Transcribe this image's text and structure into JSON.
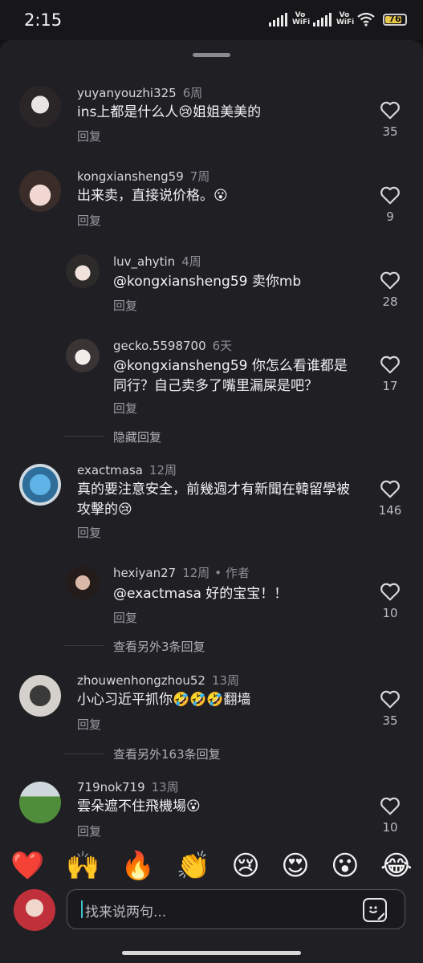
{
  "status": {
    "time": "2:15",
    "network1": "Vo\nWiFi",
    "network2": "Vo\nWiFi",
    "battery": "76"
  },
  "comments": [
    {
      "username": "yuyanyouzhi325",
      "time": "6周",
      "text": "ins上都是什么人😢姐姐美美的",
      "reply": "回复",
      "likes": "35"
    },
    {
      "username": "kongxiansheng59",
      "time": "7周",
      "text": "出来卖，直接说价格。😮",
      "reply": "回复",
      "likes": "9"
    },
    {
      "username": "luv_ahytin",
      "time": "4周",
      "text": "@kongxiansheng59 卖你mb",
      "reply": "回复",
      "likes": "28"
    },
    {
      "username": "gecko.5598700",
      "time": "6天",
      "text": "@kongxiansheng59 你怎么看谁都是同行？自己卖多了嘴里漏屎是吧？",
      "reply": "回复",
      "likes": "17"
    },
    {
      "username": "exactmasa",
      "time": "12周",
      "text": "真的要注意安全，前幾週才有新聞在韓留學被攻擊的😢",
      "reply": "回复",
      "likes": "146"
    },
    {
      "username": "hexiyan27",
      "time": "12周",
      "author": "• 作者",
      "text": "@exactmasa 好的宝宝！！",
      "reply": "回复",
      "likes": "10"
    },
    {
      "username": "zhouwenhongzhou52",
      "time": "13周",
      "text": "小心习近平抓你🤣🤣🤣翻墙",
      "reply": "回复",
      "likes": "35"
    },
    {
      "username": "719nok719",
      "time": "13周",
      "text": "雲朵遮不住飛機場😮",
      "reply": "回复",
      "likes": "10"
    }
  ],
  "thread_actions": {
    "hide_replies": "隐藏回复",
    "view_more_1": "查看另外3条回复",
    "view_more_2": "查看另外163条回复"
  },
  "emoji_bar": [
    "❤️",
    "🙌",
    "🔥",
    "👏",
    "😢",
    "😍",
    "😮",
    "😂"
  ],
  "input": {
    "placeholder": "找来说两句..."
  },
  "colors": {
    "background": "#1f1f24",
    "accent_caret": "#3ec1c9",
    "battery": "#e8c64a"
  }
}
